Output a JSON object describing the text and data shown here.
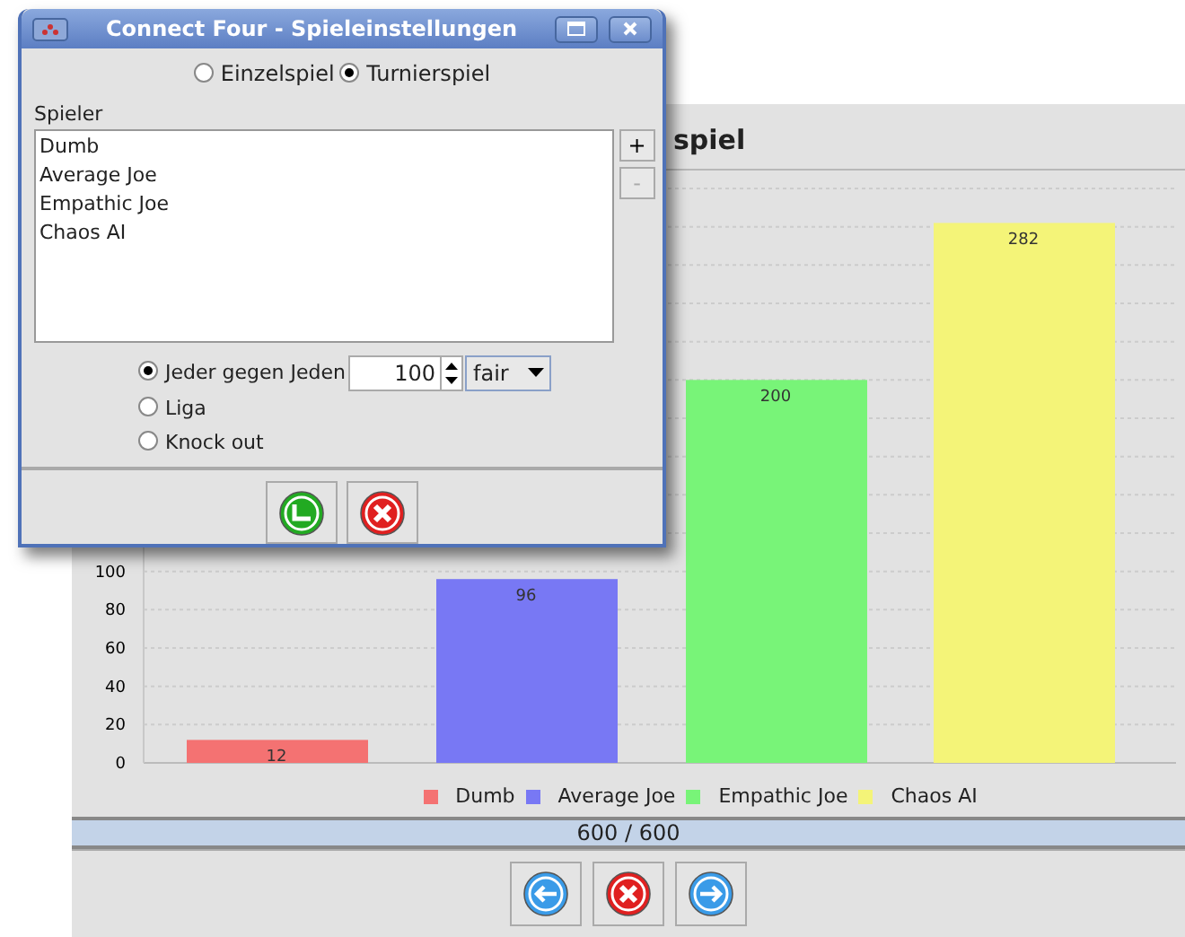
{
  "dialog": {
    "title": "Connect Four - Spieleinstellungen",
    "mode_options": [
      {
        "label": "Einzelspiel",
        "selected": false
      },
      {
        "label": "Turnierspiel",
        "selected": true
      }
    ],
    "players_label": "Spieler",
    "players": [
      "Dumb",
      "Average Joe",
      "Empathic Joe",
      "Chaos AI"
    ],
    "add_button": {
      "label": "+",
      "disabled": false
    },
    "remove_button": {
      "label": "-",
      "disabled": true
    },
    "formats": [
      {
        "label": "Jeder gegen Jeden",
        "selected": true
      },
      {
        "label": "Liga",
        "selected": false
      },
      {
        "label": "Knock out",
        "selected": false
      }
    ],
    "rounds": "100",
    "fairness": "fair"
  },
  "results": {
    "title": "spiel",
    "chart_data": {
      "type": "bar",
      "ylim": [
        0,
        300
      ],
      "yticks": [
        0,
        20,
        40,
        60,
        80,
        100
      ],
      "grid": true,
      "data_labels": true,
      "series": [
        {
          "name": "Dumb",
          "color": "#f47272",
          "values": [
            12,
            null,
            null,
            null
          ]
        },
        {
          "name": "Average Joe",
          "color": "#7878f4",
          "values": [
            null,
            96,
            null,
            null
          ]
        },
        {
          "name": "Empathic Joe",
          "color": "#78f478",
          "values": [
            null,
            null,
            200,
            null
          ]
        },
        {
          "name": "Chaos AI",
          "color": "#f4f478",
          "values": [
            null,
            null,
            null,
            282
          ]
        }
      ]
    },
    "progress": {
      "level": 1,
      "text": "600 / 600"
    }
  }
}
